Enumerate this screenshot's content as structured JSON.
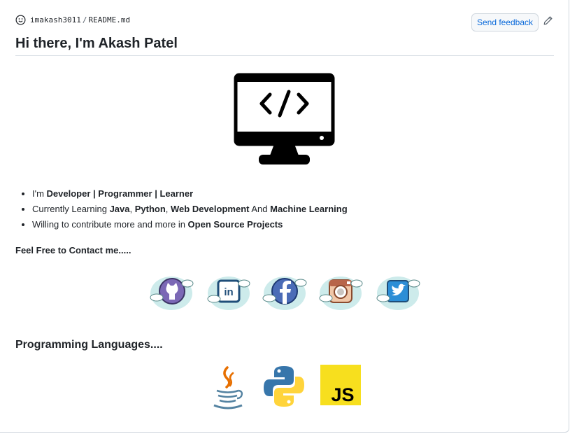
{
  "header": {
    "owner": "imakash3011",
    "separator": "/",
    "file": "README.md",
    "send_feedback_label": "Send feedback"
  },
  "readme": {
    "title": "Hi there, I'm Akash Patel",
    "bullets": [
      {
        "prefix": "I'm ",
        "parts": [
          {
            "t": "Developer | Programmer | Learner",
            "b": true
          }
        ]
      },
      {
        "prefix": "Currently Learning ",
        "parts": [
          {
            "t": "Java",
            "b": true
          },
          {
            "t": ", ",
            "b": false
          },
          {
            "t": "Python",
            "b": true
          },
          {
            "t": ", ",
            "b": false
          },
          {
            "t": "Web Development",
            "b": true
          },
          {
            "t": " And ",
            "b": false
          },
          {
            "t": "Machine Learning",
            "b": true
          }
        ]
      },
      {
        "prefix": "Willing to contribute more and more in ",
        "parts": [
          {
            "t": "Open Source Projects",
            "b": true
          }
        ]
      }
    ],
    "contact_heading": "Feel Free to Contact me.....",
    "languages_heading": "Programming Languages....",
    "social_icons": [
      "github-icon",
      "linkedin-icon",
      "facebook-icon",
      "instagram-icon",
      "twitter-icon"
    ],
    "language_icons": [
      "java-icon",
      "python-icon",
      "javascript-icon"
    ],
    "js_badge_text": "JS"
  },
  "colors": {
    "accent": "#0969da",
    "cloud": "#cdebeb",
    "js_yellow": "#f7df1e",
    "python_blue": "#3776ab",
    "python_yellow": "#ffd43b",
    "java_red": "#e76f00",
    "java_blue": "#5382a1"
  }
}
